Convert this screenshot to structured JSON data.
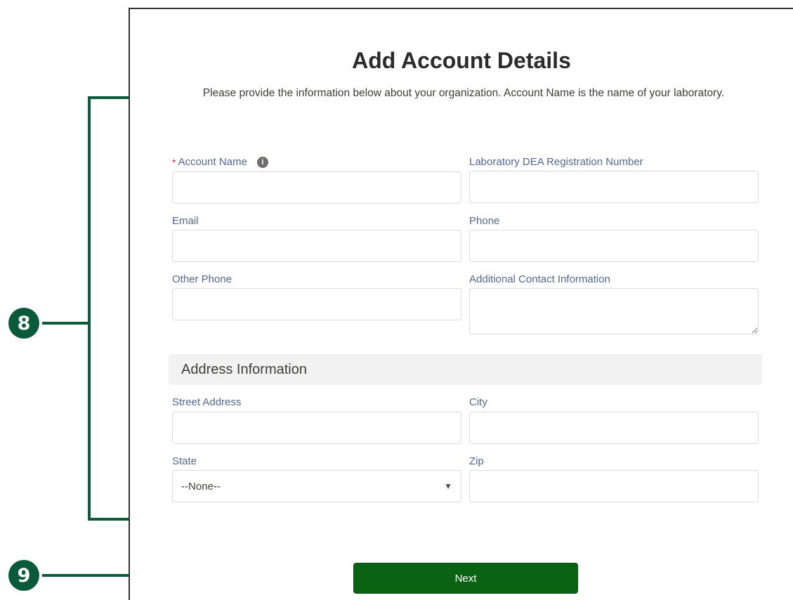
{
  "form": {
    "title": "Add Account Details",
    "subtitle": "Please provide the information below about your organization. Account Name is the name of your laboratory.",
    "required_marker": "*",
    "fields": {
      "account_name": {
        "label": "Account Name",
        "value": ""
      },
      "dea_number": {
        "label": "Laboratory DEA Registration Number",
        "value": ""
      },
      "email": {
        "label": "Email",
        "value": ""
      },
      "phone": {
        "label": "Phone",
        "value": ""
      },
      "other_phone": {
        "label": "Other Phone",
        "value": ""
      },
      "additional_contact": {
        "label": "Additional Contact Information",
        "value": ""
      }
    },
    "address_section": {
      "title": "Address Information",
      "street": {
        "label": "Street Address",
        "value": ""
      },
      "city": {
        "label": "City",
        "value": ""
      },
      "state": {
        "label": "State",
        "selected": "--None--"
      },
      "zip": {
        "label": "Zip",
        "value": ""
      }
    },
    "next_label": "Next"
  },
  "annotations": {
    "callout_8": "8",
    "callout_9": "9"
  },
  "icons": {
    "info": "info-icon",
    "dropdown": "chevron-down-icon"
  },
  "colors": {
    "annotation_green": "#0b5a3a",
    "button_green": "#0a6312",
    "required_red": "#c23934"
  }
}
